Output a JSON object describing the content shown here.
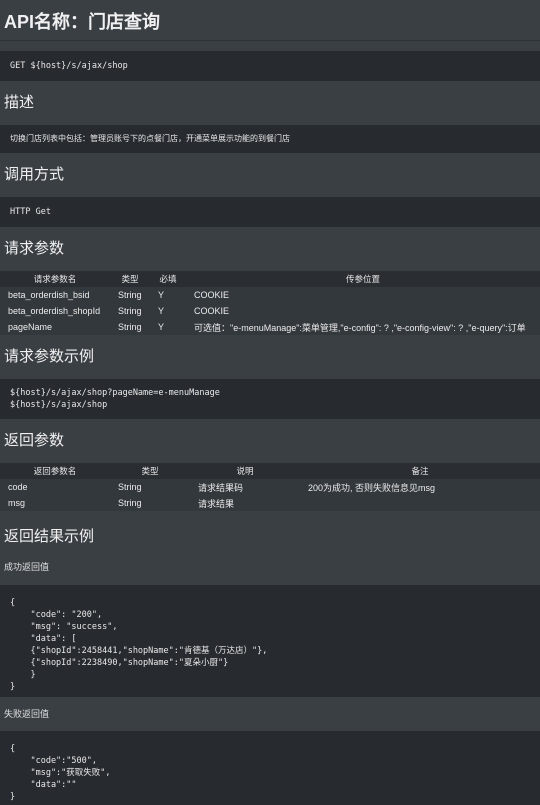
{
  "page": {
    "title": "API名称：门店查询",
    "endpoint": "GET ${host}/s/ajax/shop"
  },
  "sections": {
    "description": "描述",
    "description_text": "切换门店列表中包括：管理员账号下的点餐门店，开通菜单展示功能的到餐门店",
    "call_method": "调用方式",
    "call_method_text": "HTTP Get",
    "request_params": "请求参数",
    "request_example": "请求参数示例",
    "response_params": "返回参数",
    "response_example": "返回结果示例",
    "success_label": "成功返回值",
    "fail_label": "失败返回值"
  },
  "request_table": {
    "headers": [
      "请求参数名",
      "类型",
      "必填",
      "传参位置"
    ],
    "rows": [
      [
        "beta_orderdish_bsid",
        "String",
        "Y",
        "COOKIE"
      ],
      [
        "beta_orderdish_shopId",
        "String",
        "Y",
        "COOKIE"
      ],
      [
        "pageName",
        "String",
        "Y",
        "可选值：\"e-menuManage\":菜单管理,\"e-config\": ? ,\"e-config-view\": ? ,\"e-query\":订单"
      ]
    ]
  },
  "request_example_code": "${host}/s/ajax/shop?pageName=e-menuManage\n${host}/s/ajax/shop",
  "response_table": {
    "headers": [
      "返回参数名",
      "类型",
      "说明",
      "备注"
    ],
    "rows": [
      [
        "code",
        "String",
        "请求结果码",
        "200为成功, 否则失败信息见msg"
      ],
      [
        "msg",
        "String",
        "请求结果",
        ""
      ]
    ]
  },
  "success_code": "{\n    \"code\": \"200\",\n    \"msg\": \"success\",\n    \"data\": [\n    {\"shopId\":2458441,\"shopName\":\"肯德基（万达店）\"},\n    {\"shopId\":2238490,\"shopName\":\"夏朵小厨\"}\n    }\n}",
  "fail_code": "{\n    \"code\":\"500\",\n    \"msg\":\"获取失败\",\n    \"data\":\"\"\n}"
}
